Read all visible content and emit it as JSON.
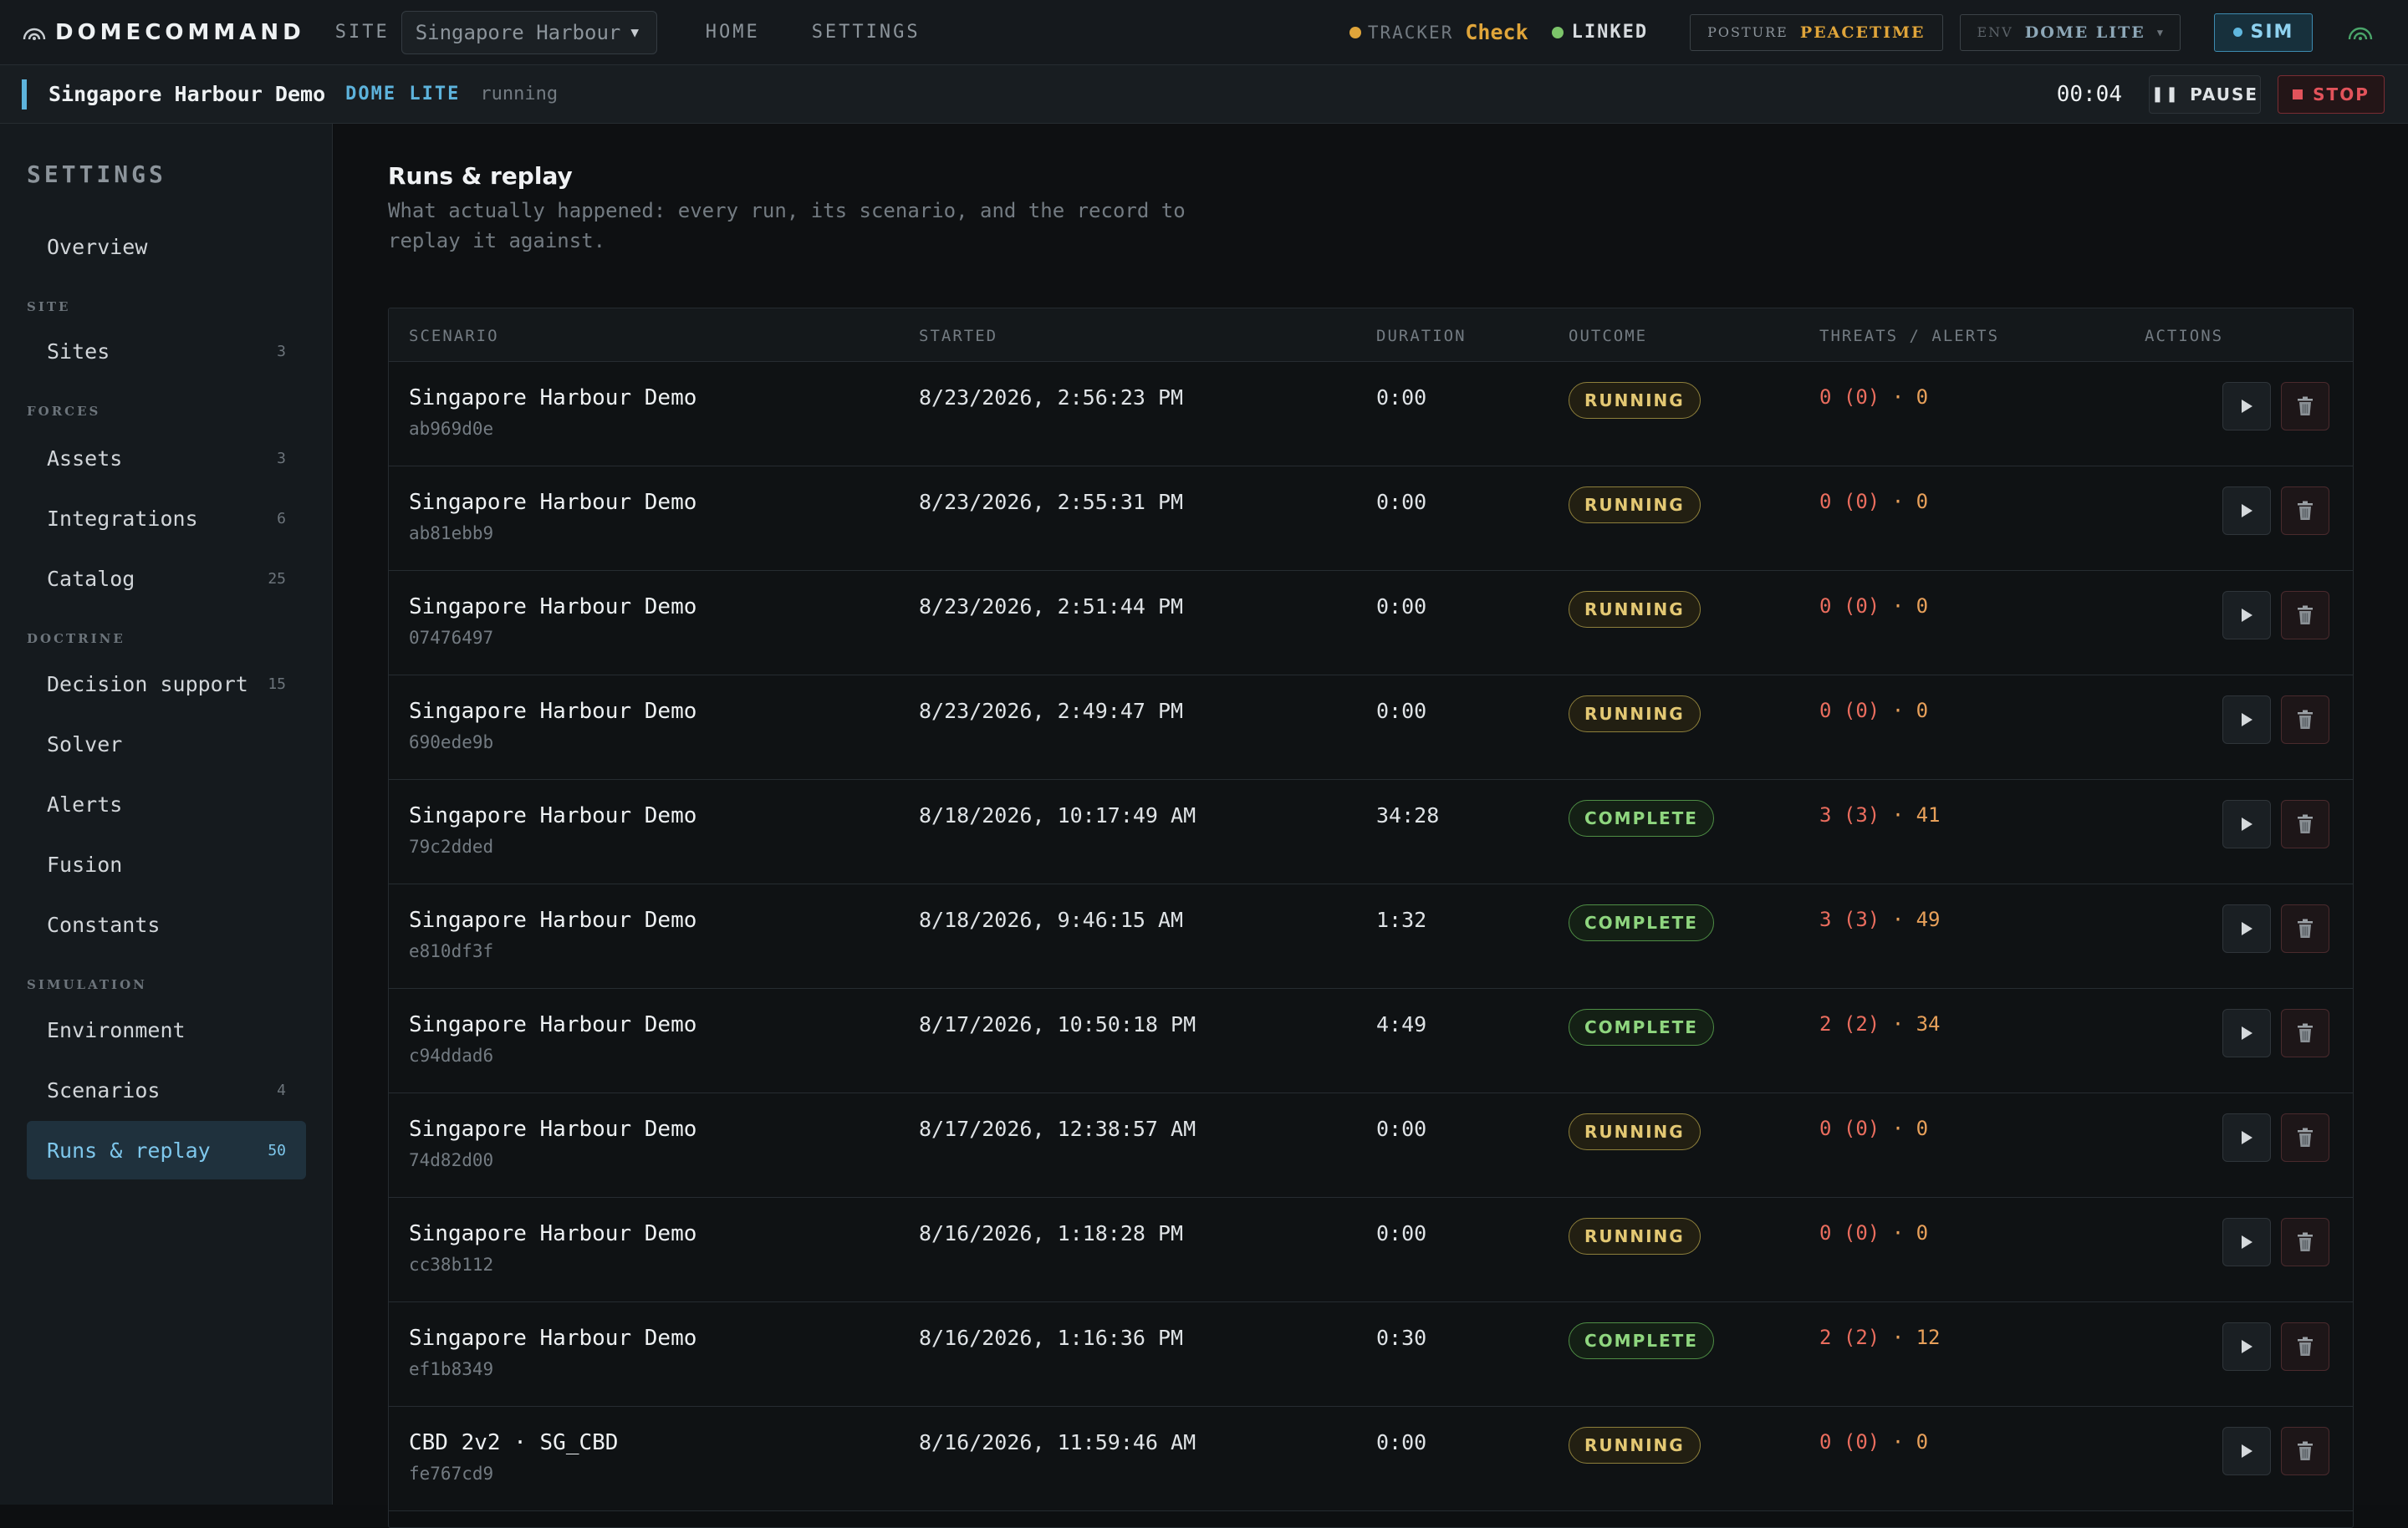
{
  "topbar": {
    "brand": "DOMECOMMAND",
    "site_label": "SITE",
    "site_value": "Singapore Harbour",
    "nav": [
      "HOME",
      "SETTINGS"
    ],
    "tracker_label": "TRACKER",
    "tracker_value": "Check",
    "linked_label": "LINKED",
    "posture_label": "POSTURE",
    "posture_value": "PEACETIME",
    "env_label": "ENV",
    "env_value": "DOME LITE",
    "sim_label": "SIM"
  },
  "colors": {
    "accent": "#5db3dc",
    "warning": "#e0a53a",
    "linked": "#7cc46a",
    "stop": "#e2535b",
    "running": "#e3c873",
    "complete": "#8fd67f"
  },
  "runbar": {
    "name": "Singapore Harbour Demo",
    "env": "DOME LITE",
    "state": "running",
    "timer": "00:04",
    "pause_label": "PAUSE",
    "stop_label": "STOP"
  },
  "sidebar": {
    "title": "SETTINGS",
    "overview": "Overview",
    "groups": {
      "site": "SITE",
      "forces": "FORCES",
      "doctrine": "DOCTRINE",
      "simulation": "SIMULATION"
    },
    "items": {
      "sites": {
        "label": "Sites",
        "count": "3"
      },
      "assets": {
        "label": "Assets",
        "count": "3"
      },
      "integrations": {
        "label": "Integrations",
        "count": "6"
      },
      "catalog": {
        "label": "Catalog",
        "count": "25"
      },
      "decision_support": {
        "label": "Decision support",
        "count": "15"
      },
      "solver": {
        "label": "Solver"
      },
      "alerts": {
        "label": "Alerts"
      },
      "fusion": {
        "label": "Fusion"
      },
      "constants": {
        "label": "Constants"
      },
      "environment": {
        "label": "Environment"
      },
      "scenarios": {
        "label": "Scenarios",
        "count": "4"
      },
      "runs_replay": {
        "label": "Runs & replay",
        "count": "50"
      }
    }
  },
  "main": {
    "title": "Runs & replay",
    "description": "What actually happened: every run, its scenario, and the record to replay it against."
  },
  "table": {
    "headers": {
      "scenario": "SCENARIO",
      "started": "STARTED",
      "duration": "DURATION",
      "outcome": "OUTCOME",
      "threats": "THREATS / ALERTS",
      "actions": "ACTIONS"
    },
    "rows": [
      {
        "name": "Singapore Harbour Demo",
        "id": "ab969d0e",
        "started": "8/23/2026, 2:56:23 PM",
        "duration": "0:00",
        "outcome": "RUNNING",
        "status": "running",
        "threats": "0 (0)",
        "sep": "·",
        "alerts": "0"
      },
      {
        "name": "Singapore Harbour Demo",
        "id": "ab81ebb9",
        "started": "8/23/2026, 2:55:31 PM",
        "duration": "0:00",
        "outcome": "RUNNING",
        "status": "running",
        "threats": "0 (0)",
        "sep": "·",
        "alerts": "0"
      },
      {
        "name": "Singapore Harbour Demo",
        "id": "07476497",
        "started": "8/23/2026, 2:51:44 PM",
        "duration": "0:00",
        "outcome": "RUNNING",
        "status": "running",
        "threats": "0 (0)",
        "sep": "·",
        "alerts": "0"
      },
      {
        "name": "Singapore Harbour Demo",
        "id": "690ede9b",
        "started": "8/23/2026, 2:49:47 PM",
        "duration": "0:00",
        "outcome": "RUNNING",
        "status": "running",
        "threats": "0 (0)",
        "sep": "·",
        "alerts": "0"
      },
      {
        "name": "Singapore Harbour Demo",
        "id": "79c2dded",
        "started": "8/18/2026, 10:17:49 AM",
        "duration": "34:28",
        "outcome": "COMPLETE",
        "status": "complete",
        "threats": "3 (3)",
        "sep": "·",
        "alerts": "41"
      },
      {
        "name": "Singapore Harbour Demo",
        "id": "e810df3f",
        "started": "8/18/2026, 9:46:15 AM",
        "duration": "1:32",
        "outcome": "COMPLETE",
        "status": "complete",
        "threats": "3 (3)",
        "sep": "·",
        "alerts": "49"
      },
      {
        "name": "Singapore Harbour Demo",
        "id": "c94ddad6",
        "started": "8/17/2026, 10:50:18 PM",
        "duration": "4:49",
        "outcome": "COMPLETE",
        "status": "complete",
        "threats": "2 (2)",
        "sep": "·",
        "alerts": "34"
      },
      {
        "name": "Singapore Harbour Demo",
        "id": "74d82d00",
        "started": "8/17/2026, 12:38:57 AM",
        "duration": "0:00",
        "outcome": "RUNNING",
        "status": "running",
        "threats": "0 (0)",
        "sep": "·",
        "alerts": "0"
      },
      {
        "name": "Singapore Harbour Demo",
        "id": "cc38b112",
        "started": "8/16/2026, 1:18:28 PM",
        "duration": "0:00",
        "outcome": "RUNNING",
        "status": "running",
        "threats": "0 (0)",
        "sep": "·",
        "alerts": "0"
      },
      {
        "name": "Singapore Harbour Demo",
        "id": "ef1b8349",
        "started": "8/16/2026, 1:16:36 PM",
        "duration": "0:30",
        "outcome": "COMPLETE",
        "status": "complete",
        "threats": "2 (2)",
        "sep": "·",
        "alerts": "12"
      },
      {
        "name": "CBD 2v2 · SG_CBD",
        "id": "fe767cd9",
        "started": "8/16/2026, 11:59:46 AM",
        "duration": "0:00",
        "outcome": "RUNNING",
        "status": "running",
        "threats": "0 (0)",
        "sep": "·",
        "alerts": "0"
      }
    ]
  }
}
